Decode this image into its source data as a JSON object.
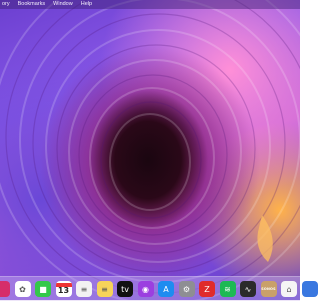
{
  "menubar": {
    "items": [
      "ory",
      "Bookmarks",
      "Window",
      "Help"
    ]
  },
  "dock": {
    "items": [
      {
        "name": "dock-edge-app",
        "glyph": "",
        "bg": "#d62d6a"
      },
      {
        "name": "photos",
        "glyph": "✿",
        "bg": "#ffffff"
      },
      {
        "name": "facetime",
        "glyph": "■",
        "bg": "#34c84a"
      },
      {
        "name": "calendar",
        "glyph": "",
        "bg": "#ffffff"
      },
      {
        "name": "reminders",
        "glyph": "≡",
        "bg": "#f2f2f2"
      },
      {
        "name": "notes",
        "glyph": "≡",
        "bg": "#f6d35a"
      },
      {
        "name": "apple-tv",
        "glyph": "tv",
        "bg": "#111111"
      },
      {
        "name": "podcasts",
        "glyph": "◉",
        "bg": "#9b3fe0"
      },
      {
        "name": "app-store",
        "glyph": "A",
        "bg": "#1e8cf0"
      },
      {
        "name": "system-preferences",
        "glyph": "⚙",
        "bg": "#8e8e93"
      },
      {
        "name": "zotero",
        "glyph": "Z",
        "bg": "#e02b2b"
      },
      {
        "name": "spotify",
        "glyph": "≋",
        "bg": "#1db954"
      },
      {
        "name": "activity-monitor",
        "glyph": "∿",
        "bg": "#2b2b2b"
      },
      {
        "name": "sonos",
        "glyph": "",
        "bg": "#c9a06a"
      },
      {
        "name": "home",
        "glyph": "⌂",
        "bg": "#f5f5f5"
      },
      {
        "name": "dock-edge-app-right",
        "glyph": "",
        "bg": "#3a78e0"
      }
    ],
    "calendar_day": "13",
    "sonos_label": "SONOS"
  }
}
